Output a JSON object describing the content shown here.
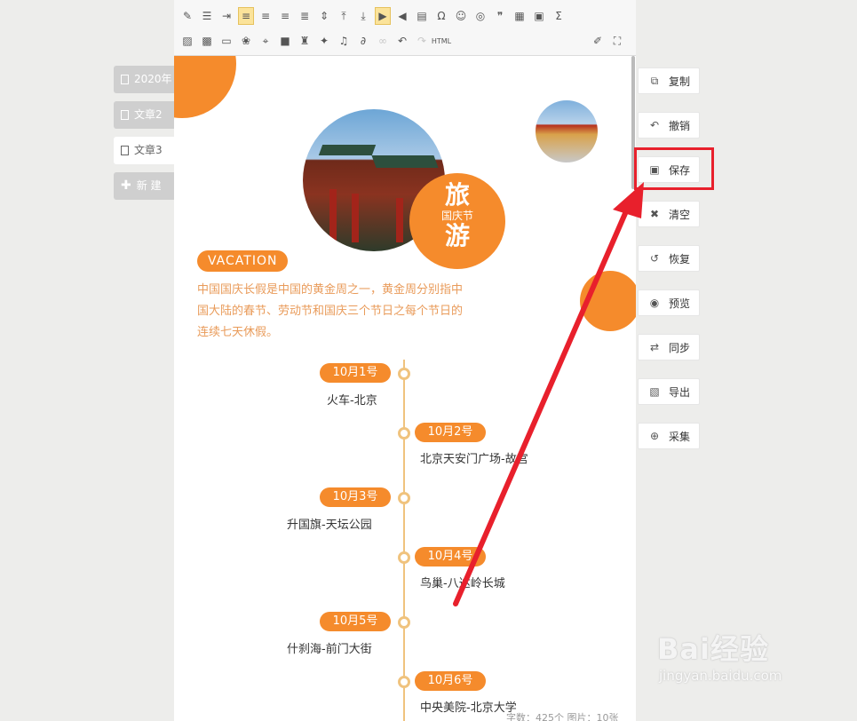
{
  "tabs": {
    "items": [
      {
        "label": "2020年"
      },
      {
        "label": "文章2"
      },
      {
        "label": "文章3"
      }
    ],
    "new_label": "新 建"
  },
  "article": {
    "badge": {
      "top": "旅",
      "middle": "国庆节",
      "bottom": "游"
    },
    "vacation_label": "VACATION",
    "intro": "中国国庆长假是中国的黄金周之一，黄金周分别指中国大陆的春节、劳动节和国庆三个节日之每个节日的连续七天休假。",
    "timeline": [
      {
        "date": "10月1号",
        "place": "火车-北京",
        "side": "left"
      },
      {
        "date": "10月2号",
        "place": "北京天安门广场-故宫",
        "side": "right"
      },
      {
        "date": "10月3号",
        "place": "升国旗-天坛公园",
        "side": "left"
      },
      {
        "date": "10月4号",
        "place": "鸟巢-八达岭长城",
        "side": "right"
      },
      {
        "date": "10月5号",
        "place": "什刹海-前门大街",
        "side": "left"
      },
      {
        "date": "10月6号",
        "place": "中央美院-北京大学",
        "side": "right"
      }
    ],
    "status": "字数：425个 图片：10张"
  },
  "actions": [
    {
      "label": "复制",
      "icon": "copy-icon"
    },
    {
      "label": "撤销",
      "icon": "undo-icon"
    },
    {
      "label": "保存",
      "icon": "save-icon"
    },
    {
      "label": "清空",
      "icon": "trash-icon"
    },
    {
      "label": "恢复",
      "icon": "restore-icon"
    },
    {
      "label": "预览",
      "icon": "eye-icon"
    },
    {
      "label": "同步",
      "icon": "sync-icon"
    },
    {
      "label": "导出",
      "icon": "export-icon"
    },
    {
      "label": "采集",
      "icon": "collect-icon"
    }
  ],
  "toolbar": {
    "html_label": "HTML"
  },
  "watermark": {
    "brand": "Bai经验",
    "url": "jingyan.baidu.com"
  },
  "colors": {
    "accent": "#f58b2c",
    "highlight": "#e8202c",
    "timeline": "#f0c37e"
  }
}
